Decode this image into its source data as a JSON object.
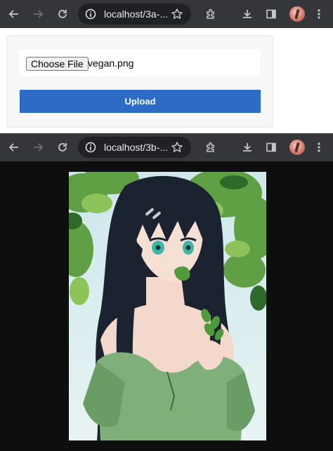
{
  "top_browser": {
    "url": "localhost/3a-..."
  },
  "upload_page": {
    "choose_file_label": "Choose File",
    "file_name": "vegan.png",
    "upload_label": "Upload"
  },
  "bottom_browser": {
    "url": "localhost/3b-..."
  },
  "image_viewer": {
    "image_subject": "anime-illustration"
  },
  "colors": {
    "toolbar": "#35363a",
    "omnibox": "#202124",
    "upload_button": "#2c6bc6",
    "viewer_background": "#0e0e0e"
  }
}
